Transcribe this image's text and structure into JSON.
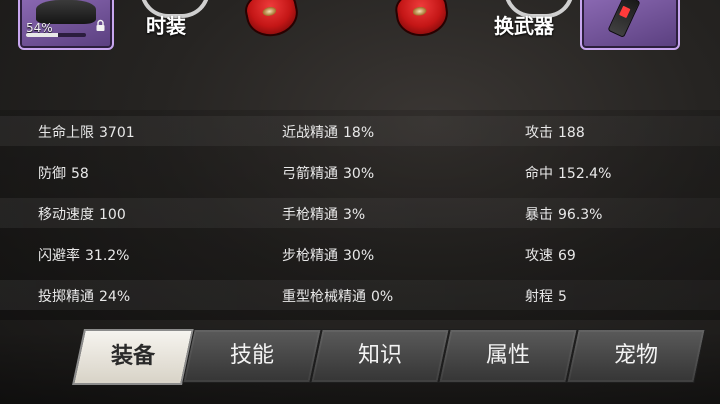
{
  "top_bar": {
    "left_slot": {
      "percent_text": "54%",
      "progress": 0.54,
      "item_icon": "dark-helmet-icon",
      "lock_icon": "lock-icon"
    },
    "costume_label": "时装",
    "weapon_label": "换武器",
    "right_slot_icon": "weapon-device-icon",
    "shoe_icon": "red-shoe-icon"
  },
  "stats": {
    "rows": [
      [
        {
          "label": "生命上限",
          "value": "3701"
        },
        {
          "label": "近战精通",
          "value": "18%"
        },
        {
          "label": "攻击",
          "value": "188"
        }
      ],
      [
        {
          "label": "防御",
          "value": "58"
        },
        {
          "label": "弓箭精通",
          "value": "30%"
        },
        {
          "label": "命中",
          "value": "152.4%"
        }
      ],
      [
        {
          "label": "移动速度",
          "value": "100"
        },
        {
          "label": "手枪精通",
          "value": "3%"
        },
        {
          "label": "暴击",
          "value": "96.3%"
        }
      ],
      [
        {
          "label": "闪避率",
          "value": "31.2%"
        },
        {
          "label": "步枪精通",
          "value": "30%"
        },
        {
          "label": "攻速",
          "value": "69"
        }
      ],
      [
        {
          "label": "投掷精通",
          "value": "24%"
        },
        {
          "label": "重型枪械精通",
          "value": "0%"
        },
        {
          "label": "射程",
          "value": "5"
        }
      ]
    ]
  },
  "tabs": [
    {
      "label": "装备",
      "active": true
    },
    {
      "label": "技能",
      "active": false
    },
    {
      "label": "知识",
      "active": false
    },
    {
      "label": "属性",
      "active": false
    },
    {
      "label": "宠物",
      "active": false
    }
  ],
  "colors": {
    "slot_purple": "#8d6bb5",
    "active_tab": "#f6f4ef",
    "inactive_tab": "#4a4a4a"
  }
}
